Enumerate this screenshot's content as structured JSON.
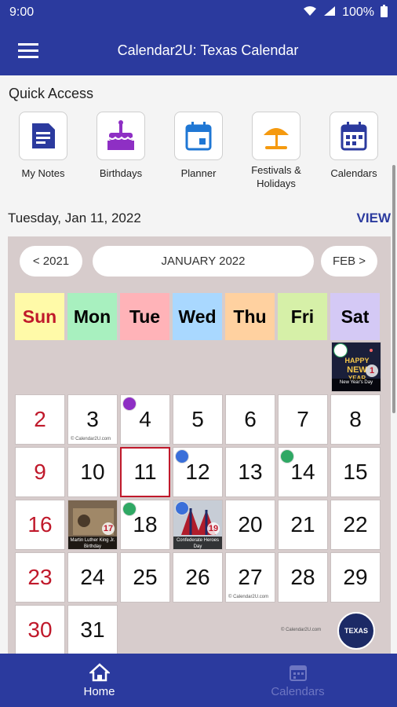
{
  "status_bar": {
    "time": "9:00",
    "battery": "100%"
  },
  "app_bar": {
    "title": "Calendar2U: Texas Calendar"
  },
  "quick_access": {
    "title": "Quick Access",
    "items": [
      {
        "label": "My Notes",
        "icon": "notes-icon"
      },
      {
        "label": "Birthdays",
        "icon": "cake-icon"
      },
      {
        "label": "Planner",
        "icon": "planner-calendar-icon"
      },
      {
        "label": "Festivals &\nHolidays",
        "icon": "beach-umbrella-icon"
      },
      {
        "label": "Calendars",
        "icon": "calendar-icon"
      }
    ]
  },
  "date_header": {
    "text": "Tuesday, Jan 11, 2022",
    "view_label": "VIEW"
  },
  "calendar": {
    "prev_label": "< 2021",
    "month_label": "JANUARY 2022",
    "next_label": "FEB >",
    "weekdays": [
      {
        "label": "Sun",
        "color": "#fffaa8",
        "text_color": "#c0192b"
      },
      {
        "label": "Mon",
        "color": "#a8f0bf",
        "text_color": "#111111"
      },
      {
        "label": "Tue",
        "color": "#ffb3b8",
        "text_color": "#111111"
      },
      {
        "label": "Wed",
        "color": "#a9d8ff",
        "text_color": "#111111"
      },
      {
        "label": "Thu",
        "color": "#ffd1a0",
        "text_color": "#111111"
      },
      {
        "label": "Fri",
        "color": "#d6f0a8",
        "text_color": "#111111"
      },
      {
        "label": "Sat",
        "color": "#d4c9f5",
        "text_color": "#111111"
      }
    ],
    "days": [
      "2",
      "3",
      "4",
      "5",
      "6",
      "7",
      "8",
      "9",
      "10",
      "11",
      "12",
      "13",
      "14",
      "15",
      "16",
      "17",
      "18",
      "19",
      "20",
      "21",
      "22",
      "23",
      "24",
      "25",
      "26",
      "27",
      "28",
      "29",
      "30",
      "31"
    ],
    "credit": "© Calendar2U.com",
    "events": {
      "new_year": {
        "caption": "New Year's Day",
        "day": "1",
        "art_text": "HAPPY NEW YEAR"
      },
      "mlk": {
        "caption": "Martin Luther King Jr. Birthday",
        "day": "17"
      },
      "confederate": {
        "caption": "Confederate Heroes Day",
        "day": "19"
      }
    },
    "texas_badge": "TEXAS",
    "today": "11"
  },
  "bottom_nav": {
    "items": [
      {
        "label": "Home",
        "icon": "home-icon",
        "active": true
      },
      {
        "label": "Calendars",
        "icon": "calendar-icon",
        "active": false
      }
    ]
  }
}
